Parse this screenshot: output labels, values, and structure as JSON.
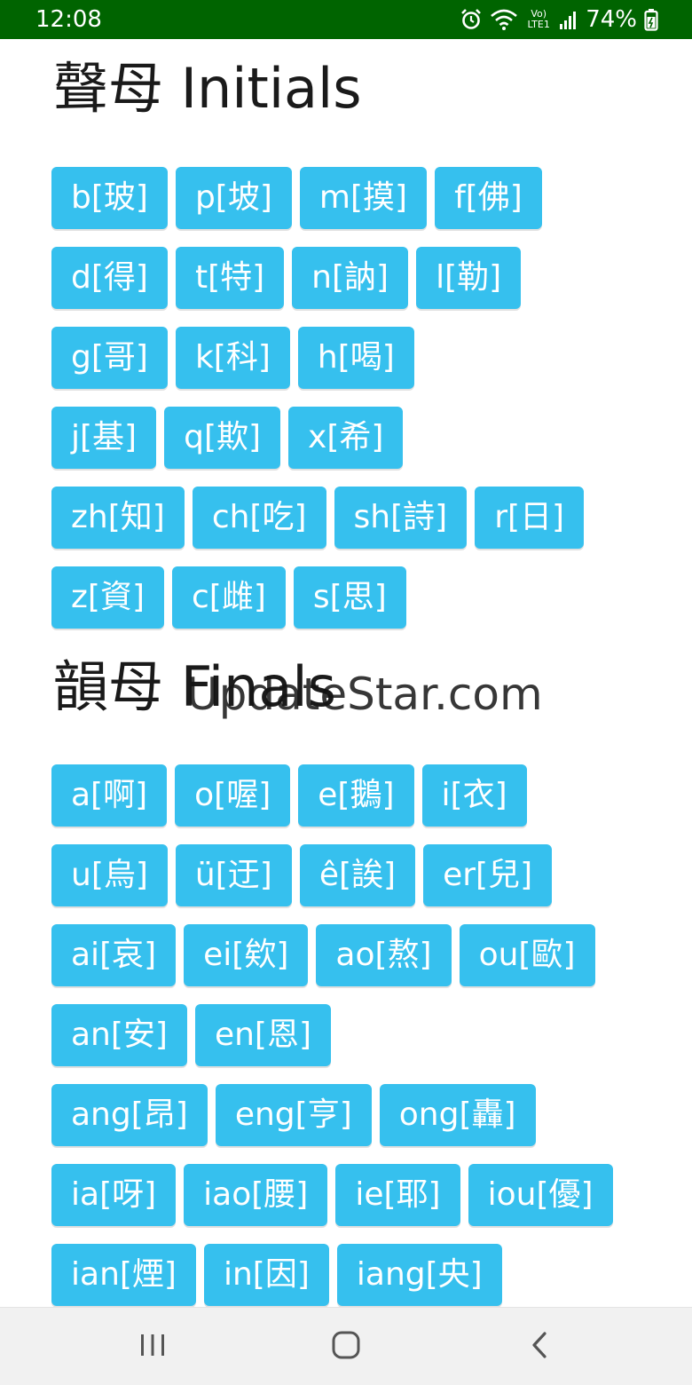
{
  "status_bar": {
    "time": "12:08",
    "battery_percent": "74%",
    "network_label": "Vo) LTE1"
  },
  "initials": {
    "title": "聲母 Initials",
    "rows": [
      [
        "b[玻]",
        "p[坡]",
        "m[摸]",
        "f[佛]"
      ],
      [
        "d[得]",
        "t[特]",
        "n[訥]",
        "l[勒]"
      ],
      [
        "g[哥]",
        "k[科]",
        "h[喝]"
      ],
      [
        "j[基]",
        "q[欺]",
        "x[希]"
      ],
      [
        "zh[知]",
        "ch[吃]",
        "sh[詩]",
        "r[日]"
      ],
      [
        "z[資]",
        "c[雌]",
        "s[思]"
      ]
    ]
  },
  "finals": {
    "title": "韻母 Finals",
    "rows": [
      [
        "a[啊]",
        "o[喔]",
        "e[鵝]",
        "i[衣]"
      ],
      [
        "u[烏]",
        "ü[迂]",
        "ê[誒]",
        "er[兒]"
      ],
      [
        "ai[哀]",
        "ei[欸]",
        "ao[熬]",
        "ou[歐]"
      ],
      [
        "an[安]",
        "en[恩]"
      ],
      [
        "ang[昂]",
        "eng[亨]",
        "ong[轟]"
      ],
      [
        "ia[呀]",
        "iao[腰]",
        "ie[耶]",
        "iou[優]"
      ],
      [
        "ian[煙]",
        "in[因]",
        "iang[央]"
      ]
    ]
  },
  "watermark": "UpdateStar.com",
  "colors": {
    "status_bar_bg": "#006400",
    "key_bg": "#36c0ee",
    "key_text": "#ffffff",
    "nav_bar_bg": "#f1f1f1"
  },
  "nav_bar": {
    "icons": [
      "recent-apps-icon",
      "home-icon",
      "back-icon"
    ]
  }
}
